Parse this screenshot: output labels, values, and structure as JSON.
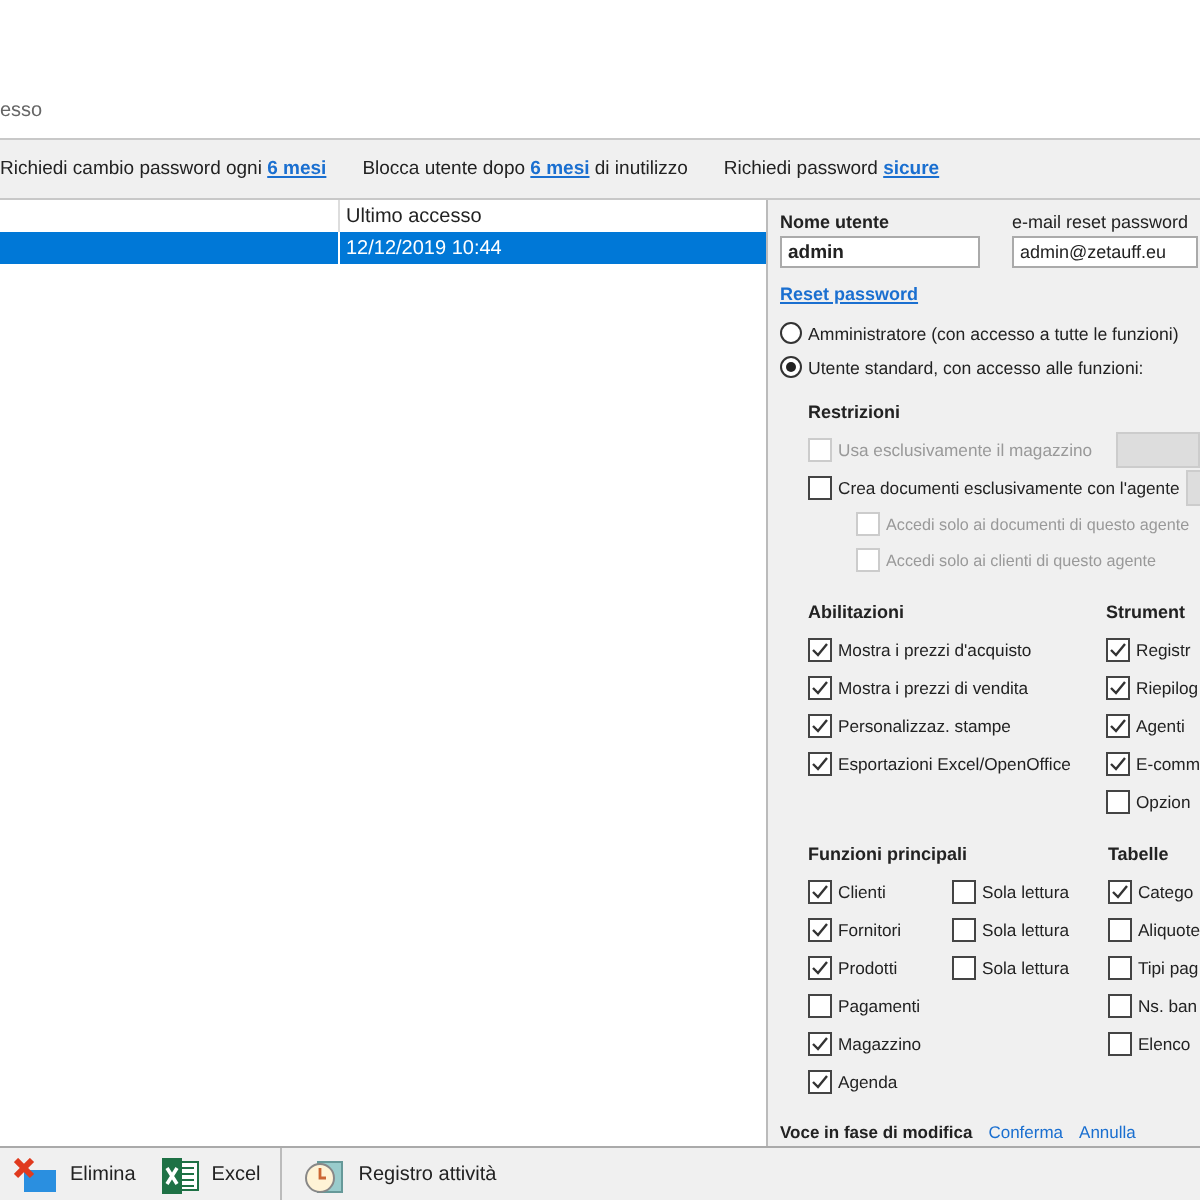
{
  "header": {
    "subtitle": "esso"
  },
  "policy_bar": [
    {
      "before": "Richiedi cambio password ogni",
      "link": "6 mesi"
    },
    {
      "before": "Blocca utente dopo",
      "link": "6 mesi",
      "after": "di inutilizzo"
    },
    {
      "before": "Richiedi password",
      "link": "sicure"
    }
  ],
  "users_table": {
    "column_2": "Ultimo accesso",
    "rows": [
      {
        "last_access": "12/12/2019  10:44",
        "selected": true
      }
    ]
  },
  "user_form": {
    "username_label": "Nome utente",
    "username": "admin",
    "email_label": "e-mail reset password",
    "email": "admin@zetauff.eu",
    "reset_link": "Reset password",
    "roles": [
      {
        "label": "Amministratore (con accesso a tutte le funzioni)",
        "selected": false
      },
      {
        "label": "Utente standard, con accesso alle funzioni:",
        "selected": true
      }
    ]
  },
  "restrictions": {
    "title": "Restrizioni",
    "items": [
      {
        "label": "Usa esclusivamente il magazzino",
        "checked": false,
        "disabled": true
      },
      {
        "label": "Crea documenti esclusivamente con l'agente",
        "checked": false,
        "disabled": false,
        "children": [
          {
            "label": "Accedi solo ai documenti di questo agente",
            "checked": false,
            "disabled": true
          },
          {
            "label": "Accedi solo ai clienti di questo agente",
            "checked": false,
            "disabled": true
          }
        ]
      }
    ]
  },
  "abilitazioni": {
    "title": "Abilitazioni",
    "items": [
      {
        "label": "Mostra i prezzi d'acquisto",
        "checked": true
      },
      {
        "label": "Mostra i prezzi di vendita",
        "checked": true
      },
      {
        "label": "Personalizzaz. stampe",
        "checked": true
      },
      {
        "label": "Esportazioni Excel/OpenOffice",
        "checked": true
      }
    ]
  },
  "strumenti": {
    "title": "Strument",
    "items": [
      {
        "label": "Registr",
        "checked": true
      },
      {
        "label": "Riepilog",
        "checked": true
      },
      {
        "label": "Agenti",
        "checked": true
      },
      {
        "label": "E-comm",
        "checked": true
      },
      {
        "label": "Opzion",
        "checked": false
      }
    ]
  },
  "funzioni_principali": {
    "title": "Funzioni principali",
    "items": [
      {
        "label": "Clienti",
        "checked": true,
        "read_only": {
          "label": "Sola lettura",
          "checked": false
        }
      },
      {
        "label": "Fornitori",
        "checked": true,
        "read_only": {
          "label": "Sola lettura",
          "checked": false
        }
      },
      {
        "label": "Prodotti",
        "checked": true,
        "read_only": {
          "label": "Sola lettura",
          "checked": false
        }
      },
      {
        "label": "Pagamenti",
        "checked": false
      },
      {
        "label": "Magazzino",
        "checked": true
      },
      {
        "label": "Agenda",
        "checked": true
      }
    ]
  },
  "tabelle": {
    "title": "Tabelle",
    "items": [
      {
        "label": "Catego",
        "checked": true
      },
      {
        "label": "Aliquote",
        "checked": false
      },
      {
        "label": "Tipi pag",
        "checked": false
      },
      {
        "label": "Ns. ban",
        "checked": false
      },
      {
        "label": "Elenco",
        "checked": false
      }
    ]
  },
  "edit_footer": {
    "status": "Voce in fase di modifica",
    "confirm": "Conferma",
    "cancel": "Annulla"
  },
  "toolbar": [
    {
      "kind": "delete",
      "label": "Elimina"
    },
    {
      "kind": "excel",
      "label": "Excel"
    },
    {
      "kind": "log",
      "label": "Registro attività"
    }
  ]
}
